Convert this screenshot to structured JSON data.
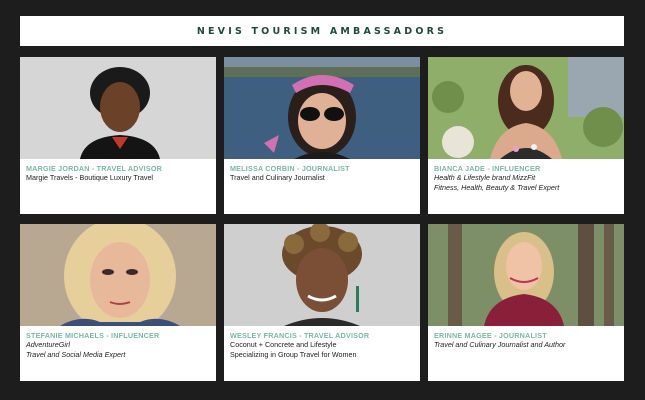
{
  "banner": {
    "title": "NEVIS TOURISM AMBASSADORS"
  },
  "colors": {
    "background": "#1d1d1d",
    "banner_text": "#1f4a3c",
    "caption_title": "#7ab8a0"
  },
  "ambassadors": [
    {
      "title": "MARGIE JORDAN - TRAVEL ADVISOR",
      "lines": [
        "Margie Travels - Boutique Luxury Travel"
      ]
    },
    {
      "title": "MELISSA CORBIN - JOURNALIST",
      "lines": [
        "Travel and Culinary Journalist"
      ]
    },
    {
      "title": "BIANCA JADE - INFLUENCER",
      "lines": [
        "Health & Lifestyle brand MizzFit",
        "Fitness, Health, Beauty & Travel Expert"
      ]
    },
    {
      "title": "STEFANIE MICHAELS - INFLUENCER",
      "lines": [
        "AdventureGirl",
        "Travel and Social Media Expert"
      ]
    },
    {
      "title": "WESLEY FRANCIS - TRAVEL ADVISOR",
      "lines": [
        "Coconut + Concrete and Lifestyle",
        "Specializing in Group Travel for Women"
      ]
    },
    {
      "title": "ERINNE MAGEE - JOURNALIST",
      "lines": [
        "Travel and Culinary Journalist and Author"
      ]
    }
  ]
}
